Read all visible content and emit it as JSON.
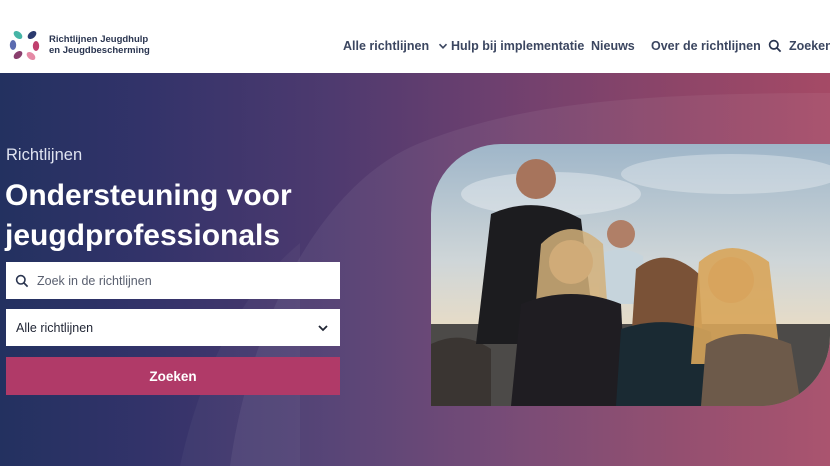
{
  "header": {
    "logo_line1": "Richtlijnen Jeugdhulp",
    "logo_line2": "en Jeugdbescherming",
    "nav": {
      "all_guidelines": "Alle richtlijnen",
      "implementation_help": "Hulp bij implementatie",
      "news": "Nieuws",
      "about": "Over de richtlijnen",
      "search": "Zoeken"
    }
  },
  "hero": {
    "eyebrow": "Richtlijnen",
    "title_line1": "Ondersteuning voor",
    "title_line2": "jeugdprofessionals",
    "search_placeholder": "Zoek in de richtlijnen",
    "select_value": "Alle richtlijnen",
    "search_button": "Zoeken"
  },
  "colors": {
    "brand_pink": "#b03a68",
    "header_text": "#3b4660",
    "hero_start": "#233160",
    "hero_end": "#a54a66"
  },
  "icons": {
    "logo": "pinwheel-logo-icon",
    "nav_dropdown": "chevron-down-icon",
    "nav_search": "search-icon",
    "input_search": "search-icon",
    "select_dropdown": "chevron-down-icon"
  }
}
